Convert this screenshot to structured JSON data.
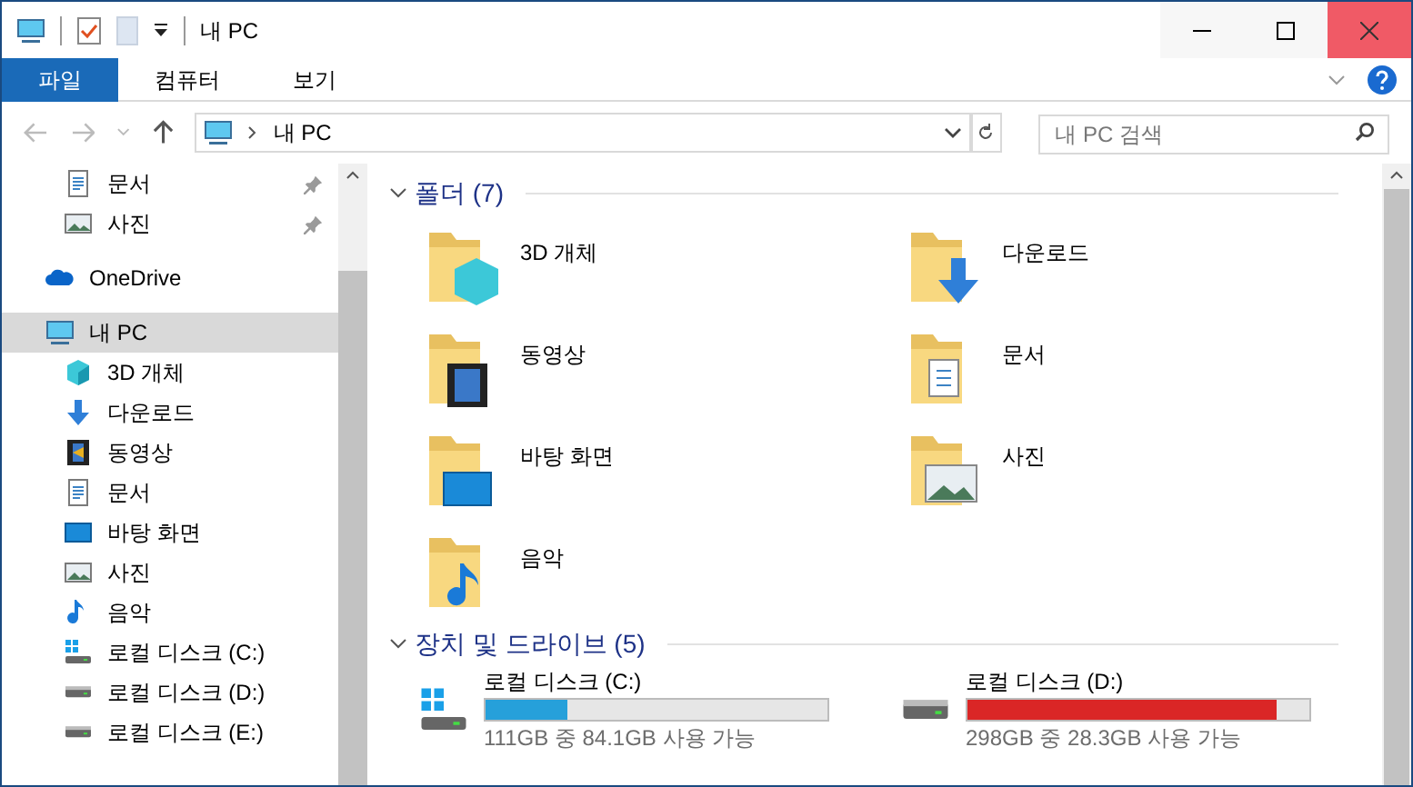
{
  "window": {
    "title": "내 PC"
  },
  "ribbon_tabs": [
    {
      "label": "파일",
      "selected": true
    },
    {
      "label": "컴퓨터",
      "selected": false
    },
    {
      "label": "보기",
      "selected": false
    }
  ],
  "address": {
    "path": "내 PC"
  },
  "search": {
    "placeholder": "내 PC 검색"
  },
  "sidebar": {
    "items": [
      {
        "label": "문서",
        "kind": "document",
        "pinned": true,
        "selected": false
      },
      {
        "label": "사진",
        "kind": "pictures",
        "pinned": true,
        "selected": false
      },
      {
        "label": "OneDrive",
        "kind": "cloud",
        "pinned": false,
        "selected": false
      },
      {
        "label": "내 PC",
        "kind": "pc",
        "pinned": false,
        "selected": true,
        "children": [
          {
            "label": "3D 개체",
            "kind": "cube",
            "pinned": false,
            "selected": false
          },
          {
            "label": "다운로드",
            "kind": "download",
            "pinned": false,
            "selected": false
          },
          {
            "label": "동영상",
            "kind": "video",
            "pinned": false,
            "selected": false
          },
          {
            "label": "문서",
            "kind": "document",
            "pinned": false,
            "selected": false
          },
          {
            "label": "바탕 화면",
            "kind": "desktop",
            "pinned": false,
            "selected": false
          },
          {
            "label": "사진",
            "kind": "pictures",
            "pinned": false,
            "selected": false
          },
          {
            "label": "음악",
            "kind": "music",
            "pinned": false,
            "selected": false
          },
          {
            "label": "로컬 디스크 (C:)",
            "kind": "system-drive",
            "pinned": false,
            "selected": false
          },
          {
            "label": "로컬 디스크 (D:)",
            "kind": "drive",
            "pinned": false,
            "selected": false
          },
          {
            "label": "로컬 디스크 (E:)",
            "kind": "drive",
            "pinned": false,
            "selected": false
          }
        ]
      }
    ]
  },
  "folders": {
    "title": "폴더 (7)",
    "expanded": true,
    "items": [
      {
        "label": "3D 개체",
        "kind": "cube"
      },
      {
        "label": "다운로드",
        "kind": "download"
      },
      {
        "label": "동영상",
        "kind": "video"
      },
      {
        "label": "문서",
        "kind": "document"
      },
      {
        "label": "바탕 화면",
        "kind": "desktop"
      },
      {
        "label": "사진",
        "kind": "pictures"
      },
      {
        "label": "음악",
        "kind": "music"
      }
    ]
  },
  "drives": {
    "title": "장치 및 드라이브 (5)",
    "expanded": true,
    "items": [
      {
        "label": "로컬 디스크 (C:)",
        "kind": "system-drive",
        "level": 0.24,
        "low_space": false,
        "free": "111GB 중 84.1GB 사용 가능"
      },
      {
        "label": "로컬 디스크 (D:)",
        "kind": "drive",
        "level": 0.905,
        "low_space": true,
        "free": "298GB 중 28.3GB 사용 가능"
      }
    ]
  }
}
